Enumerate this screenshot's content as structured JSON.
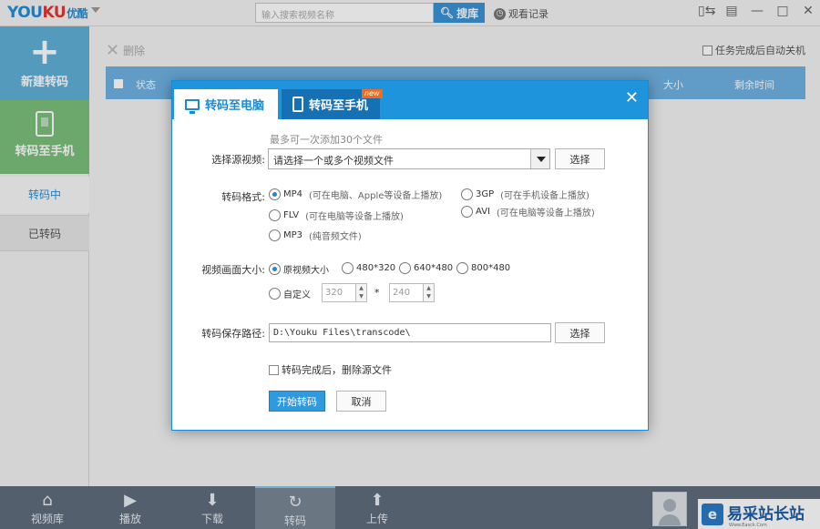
{
  "topbar": {
    "logo_youku_part1": "YOU",
    "logo_youku_part2": "KU",
    "logo_cn": "优酷",
    "search_placeholder": "输入搜索视频名称",
    "search_button": "搜库",
    "history": "观看记录"
  },
  "sidebar": {
    "new_convert": "新建转码",
    "convert_to_phone": "转码至手机",
    "converting": "转码中",
    "converted": "已转码"
  },
  "main": {
    "delete": "删除",
    "auto_shutdown": "任务完成后自动关机",
    "columns": [
      "状态",
      "大小",
      "剩余时间"
    ]
  },
  "bottombar": {
    "items": [
      {
        "label": "视频库",
        "icon": "home-icon"
      },
      {
        "label": "播放",
        "icon": "play-icon"
      },
      {
        "label": "下载",
        "icon": "download-icon"
      },
      {
        "label": "转码",
        "icon": "convert-icon"
      },
      {
        "label": "上传",
        "icon": "upload-icon"
      }
    ],
    "active": "转码"
  },
  "watermark": {
    "text": "易采站长站",
    "sub": "Www.Easck.Com"
  },
  "dialog": {
    "tab_pc": "转码至电脑",
    "tab_phone": "转码至手机",
    "new_badge": "new",
    "hint": "最多可一次添加30个文件",
    "source_label": "选择源视频:",
    "source_placeholder": "请选择一个或多个视频文件",
    "choose": "选择",
    "format_label": "转码格式:",
    "formats": [
      {
        "name": "MP4",
        "desc": "(可在电脑、Apple等设备上播放)",
        "selected": true
      },
      {
        "name": "3GP",
        "desc": "(可在手机设备上播放)",
        "selected": false
      },
      {
        "name": "FLV",
        "desc": "(可在电脑等设备上播放)",
        "selected": false
      },
      {
        "name": "AVI",
        "desc": "(可在电脑等设备上播放)",
        "selected": false
      },
      {
        "name": "MP3",
        "desc": "(纯音频文件)",
        "selected": false
      }
    ],
    "size_label": "视频画面大小:",
    "sizes": [
      {
        "name": "原视频大小",
        "selected": true
      },
      {
        "name": "480*320",
        "selected": false
      },
      {
        "name": "640*480",
        "selected": false
      },
      {
        "name": "800*480",
        "selected": false
      }
    ],
    "custom": "自定义",
    "custom_w": "320",
    "custom_h": "240",
    "times": "*",
    "path_label": "转码保存路径:",
    "path_value": "D:\\Youku Files\\transcode\\",
    "delete_source": "转码完成后，删除源文件",
    "start": "开始转码",
    "cancel": "取消"
  }
}
